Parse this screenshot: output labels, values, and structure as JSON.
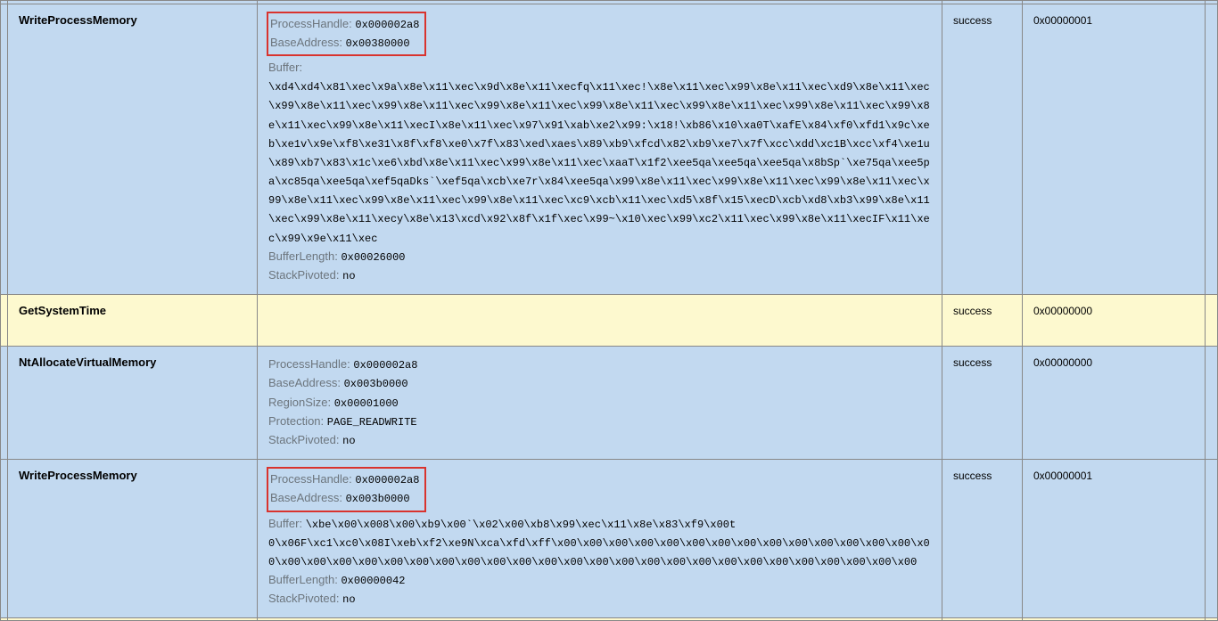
{
  "rows": [
    {
      "api": "WriteProcessMemory",
      "status": "success",
      "return": "0x00000001",
      "highlight": [
        {
          "label": "ProcessHandle:",
          "value": "0x000002a8"
        },
        {
          "label": "BaseAddress:",
          "value": "0x00380000"
        }
      ],
      "args": [
        {
          "label": "Buffer:",
          "value": "\\xd4\\xd4\\x81\\xec\\x9a\\x8e\\x11\\xec\\x9d\\x8e\\x11\\xecfq\\x11\\xec!\\x8e\\x11\\xec\\x99\\x8e\\x11\\xec\\xd9\\x8e\\x11\\xec\\x99\\x8e\\x11\\xec\\x99\\x8e\\x11\\xec\\x99\\x8e\\x11\\xec\\x99\\x8e\\x11\\xec\\x99\\x8e\\x11\\xec\\x99\\x8e\\x11\\xec\\x99\\x8e\\x11\\xec\\x99\\x8e\\x11\\xecI\\x8e\\x11\\xec\\x97\\x91\\xab\\xe2\\x99:\\x18!\\xb86\\x10\\xa0T\\xafE\\x84\\xf0\\xfd1\\x9c\\xeb\\xe1v\\x9e\\xf8\\xe31\\x8f\\xf8\\xe0\\x7f\\x83\\xed\\xaes\\x89\\xb9\\xfcd\\x82\\xb9\\xe7\\x7f\\xcc\\xdd\\xc1B\\xcc\\xf4\\xe1u\\x89\\xb7\\x83\\x1c\\xe6\\xbd\\x8e\\x11\\xec\\x99\\x8e\\x11\\xec\\xaaT\\x1f2\\xee5qa\\xee5qa\\xee5qa\\x8bSp`\\xe75qa\\xee5pa\\xc85qa\\xee5qa\\xef5qaDks`\\xef5qa\\xcb\\xe7r\\x84\\xee5qa\\x99\\x8e\\x11\\xec\\x99\\x8e\\x11\\xec\\x99\\x8e\\x11\\xec\\x99\\x8e\\x11\\xec\\x99\\x8e\\x11\\xec\\x99\\x8e\\x11\\xec\\xc9\\xcb\\x11\\xec\\xd5\\x8f\\x15\\xecD\\xcb\\xd8\\xb3\\x99\\x8e\\x11\\xec\\x99\\x8e\\x11\\xecy\\x8e\\x13\\xcd\\x92\\x8f\\x1f\\xec\\x99~\\x10\\xec\\x99\\xc2\\x11\\xec\\x99\\x8e\\x11\\xecIF\\x11\\xec\\x99\\x9e\\x11\\xec"
        },
        {
          "label": "BufferLength:",
          "value": "0x00026000"
        },
        {
          "label": "StackPivoted:",
          "value": "no"
        }
      ]
    },
    {
      "api": "GetSystemTime",
      "status": "success",
      "return": "0x00000000",
      "args": []
    },
    {
      "api": "NtAllocateVirtualMemory",
      "status": "success",
      "return": "0x00000000",
      "args": [
        {
          "label": "ProcessHandle:",
          "value": "0x000002a8"
        },
        {
          "label": "BaseAddress:",
          "value": "0x003b0000"
        },
        {
          "label": "RegionSize:",
          "value": "0x00001000"
        },
        {
          "label": "Protection:",
          "value": "PAGE_READWRITE"
        },
        {
          "label": "StackPivoted:",
          "value": "no"
        }
      ]
    },
    {
      "api": "WriteProcessMemory",
      "status": "success",
      "return": "0x00000001",
      "highlight": [
        {
          "label": "ProcessHandle:",
          "value": "0x000002a8"
        },
        {
          "label": "BaseAddress:",
          "value": "0x003b0000"
        }
      ],
      "args": [
        {
          "label": "Buffer:",
          "value": "\\xbe\\x00\\x008\\x00\\xb9\\x00`\\x02\\x00\\xb8\\x99\\xec\\x11\\x8e\\x83\\xf9\\x00t 0\\x06F\\xc1\\xc0\\x08I\\xeb\\xf2\\xe9N\\xca\\xfd\\xff\\x00\\x00\\x00\\x00\\x00\\x00\\x00\\x00\\x00\\x00\\x00\\x00\\x00\\x00\\x00\\x00\\x00\\x00\\x00\\x00\\x00\\x00\\x00\\x00\\x00\\x00\\x00\\x00\\x00\\x00\\x00\\x00\\x00\\x00\\x00\\x00\\x00\\x00\\x00\\x00"
        },
        {
          "label": "BufferLength:",
          "value": "0x00000042"
        },
        {
          "label": "StackPivoted:",
          "value": "no"
        }
      ]
    }
  ]
}
